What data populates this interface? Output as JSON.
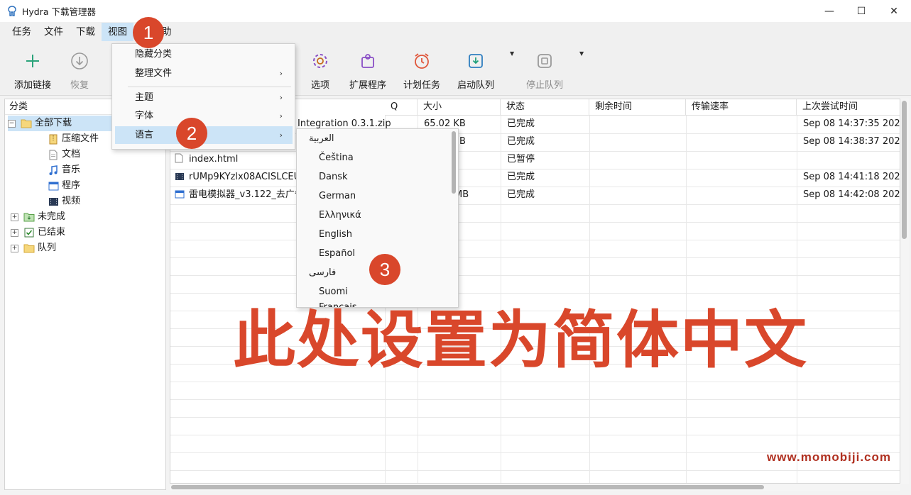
{
  "window": {
    "title": "Hydra 下载管理器",
    "controls": {
      "minimize": "—",
      "maximize": "☐",
      "close": "✕"
    }
  },
  "menubar": {
    "items": [
      "任务",
      "文件",
      "下载",
      "视图",
      "帮助"
    ],
    "help_visible_suffix": "助"
  },
  "toolbar": {
    "add_link": "添加链接",
    "resume": "恢复",
    "options": "选项",
    "extensions": "扩展程序",
    "scheduler": "计划任务",
    "start_queue": "启动队列",
    "stop_queue": "停止队列",
    "icons": {
      "add_link": "plus-icon",
      "resume": "download-circle-icon",
      "options": "gear-icon",
      "extensions": "puzzle-icon",
      "scheduler": "alarm-clock-icon",
      "start_queue": "tray-download-icon",
      "stop_queue": "stop-square-icon"
    }
  },
  "sidebar": {
    "header": "分类",
    "all_downloads": "全部下载",
    "children": [
      {
        "label": "压缩文件",
        "icon": "zip-icon"
      },
      {
        "label": "文档",
        "icon": "document-icon"
      },
      {
        "label": "音乐",
        "icon": "music-icon"
      },
      {
        "label": "程序",
        "icon": "program-icon"
      },
      {
        "label": "视频",
        "icon": "video-icon"
      }
    ],
    "groups": [
      {
        "label": "未完成",
        "icon": "incomplete-folder-icon"
      },
      {
        "label": "已结束",
        "icon": "checkbox-icon"
      },
      {
        "label": "队列",
        "icon": "folder-icon"
      }
    ]
  },
  "table": {
    "columns": [
      "Q",
      "大小",
      "状态",
      "剩余时间",
      "传输速率",
      "上次尝试时间"
    ],
    "rows": [
      {
        "name": "Integration 0.3.1.zip",
        "size": "65.02 KB",
        "status": "已完成",
        "last_try": "Sep 08 14:37:35 2026",
        "icon": "zip-icon"
      },
      {
        "name": "",
        "size": "B",
        "status": "已完成",
        "last_try": "Sep 08 14:38:37 2026",
        "icon": ""
      },
      {
        "name": "index.html",
        "size": "",
        "status": "已暂停",
        "last_try": "",
        "icon": "document-icon"
      },
      {
        "name": "rUMp9KYzlx08ACISLCEU0",
        "size": "",
        "status": "已完成",
        "last_try": "Sep 08 14:41:18 2026",
        "icon": "video-icon"
      },
      {
        "name": "雷电模拟器_v3.122_去广告",
        "size": "MB",
        "status": "已完成",
        "last_try": "Sep 08 14:42:08 2026",
        "icon": "program-icon"
      }
    ]
  },
  "view_menu": {
    "items": [
      {
        "label": "隐藏分类",
        "submenu": false
      },
      {
        "label": "整理文件",
        "submenu": true
      },
      {
        "label": "主题",
        "submenu": true
      },
      {
        "label": "字体",
        "submenu": true
      },
      {
        "label": "语言",
        "submenu": true
      }
    ],
    "arrow": "›"
  },
  "language_menu": {
    "items": [
      "العربية",
      "Čeština",
      "Dansk",
      "German",
      "Ελληνικά",
      "English",
      "Español",
      "فارسی",
      "Suomi"
    ],
    "cut_item": "Français"
  },
  "annotations": {
    "badges": [
      "1",
      "2",
      "3"
    ],
    "caption": "此处设置为简体中文",
    "website": "www.momobiji.com",
    "accent_color": "#d9472b"
  }
}
